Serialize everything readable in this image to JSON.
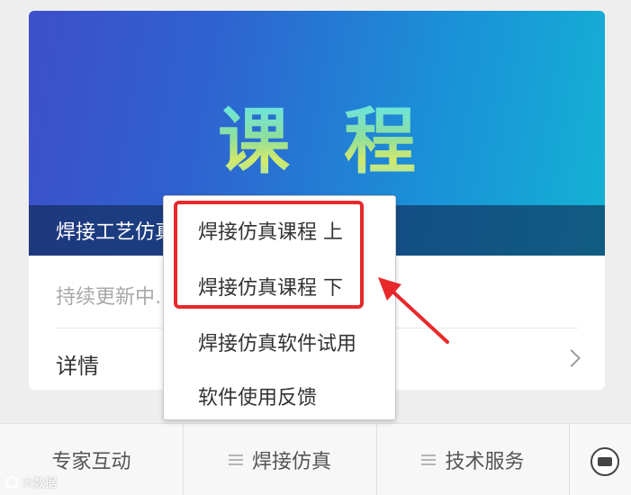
{
  "course_card": {
    "banner_title": "课程",
    "caption": "焊接工艺仿真课程（共16课时）",
    "subtitle": "持续更新中……",
    "details_label": "详情"
  },
  "popup_menu": {
    "items": [
      {
        "label": "焊接仿真课程 上",
        "highlighted": true
      },
      {
        "label": "焊接仿真课程 下",
        "highlighted": true
      },
      {
        "label": "焊接仿真软件试用",
        "highlighted": false
      },
      {
        "label": "软件使用反馈",
        "highlighted": false
      }
    ]
  },
  "bottom_nav": {
    "items": [
      {
        "label": "专家互动",
        "icon": "none"
      },
      {
        "label": "焊接仿真",
        "icon": "menu-icon"
      },
      {
        "label": "技术服务",
        "icon": "menu-icon"
      }
    ],
    "keyboard_icon": "keyboard-icon"
  },
  "annotation": {
    "box_color": "#e8282b",
    "arrow_color": "#e8282b"
  },
  "watermark": "大数据"
}
